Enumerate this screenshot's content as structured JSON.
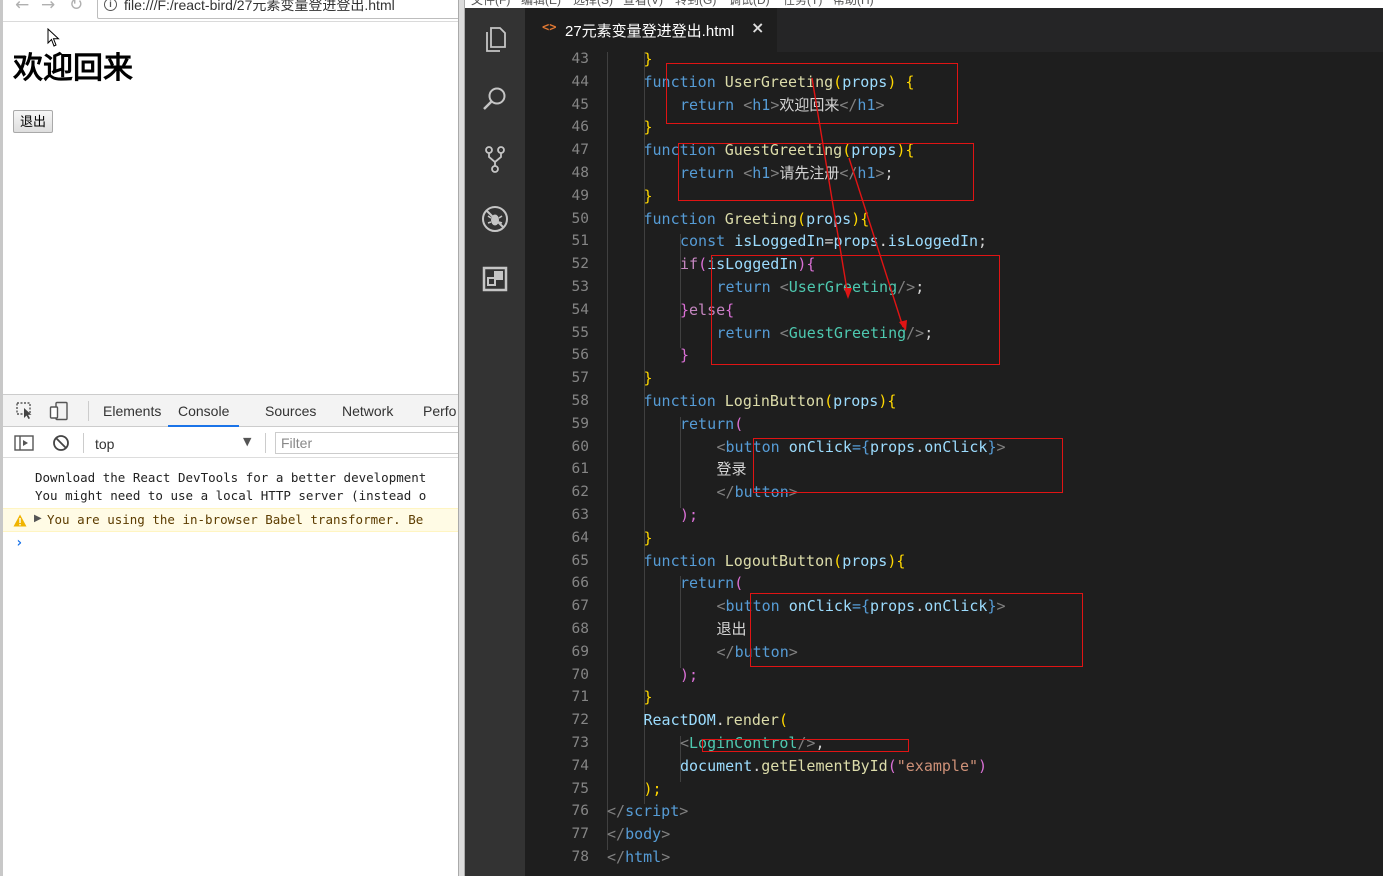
{
  "browser": {
    "url": "file:///F:/react-bird/27元素变量登进登出.html",
    "page_heading": "欢迎回来",
    "logout_button": "退出",
    "devtools": {
      "tabs": [
        "Elements",
        "Console",
        "Sources",
        "Network",
        "Perfo"
      ],
      "active_tab": "Console",
      "context": "top",
      "filter_placeholder": "Filter",
      "messages": [
        "Download the React DevTools for a better development",
        "You might need to use a local HTTP server (instead o",
        "You are using the in-browser Babel transformer. Be"
      ]
    }
  },
  "editor": {
    "menu": [
      "文件(F)",
      "编辑(E)",
      "选择(S)",
      "查看(V)",
      "转到(G)",
      "调试(D)",
      "任务(T)",
      "帮助(H)"
    ],
    "tab": {
      "icon": "<>",
      "label": "27元素变量登进登出.html"
    },
    "activity_icons": [
      "files-icon",
      "search-icon",
      "source-control-icon",
      "debug-icon",
      "extensions-icon"
    ],
    "lines": [
      {
        "n": "43",
        "tokens": [
          [
            "}",
            "t-yel"
          ]
        ],
        "indent": 2
      },
      {
        "n": "44",
        "tokens": [
          [
            "function ",
            "t-kw"
          ],
          [
            "UserGreeting",
            "t-fn"
          ],
          [
            "(",
            "t-par"
          ],
          [
            "props",
            "t-var"
          ],
          ") ",
          "t-par"
        ],
        "indent": 2
      },
      {
        "n": "45",
        "tokens": [],
        "indent": 3
      },
      {
        "n": "46",
        "tokens": [],
        "indent": 2
      },
      {
        "n": "47",
        "tokens": [],
        "indent": 2
      },
      {
        "n": "48",
        "tokens": [],
        "indent": 3
      },
      {
        "n": "49",
        "tokens": [],
        "indent": 2
      },
      {
        "n": "50",
        "tokens": [],
        "indent": 2
      },
      {
        "n": "51",
        "tokens": [],
        "indent": 3
      },
      {
        "n": "52",
        "tokens": [],
        "indent": 3
      },
      {
        "n": "53",
        "tokens": [],
        "indent": 4
      },
      {
        "n": "54",
        "tokens": [],
        "indent": 3
      },
      {
        "n": "55",
        "tokens": [],
        "indent": 4
      },
      {
        "n": "56",
        "tokens": [],
        "indent": 3
      },
      {
        "n": "57",
        "tokens": [],
        "indent": 2
      },
      {
        "n": "58",
        "tokens": [],
        "indent": 2
      },
      {
        "n": "59",
        "tokens": [],
        "indent": 3
      },
      {
        "n": "60",
        "tokens": [],
        "indent": 4
      },
      {
        "n": "61",
        "tokens": [],
        "indent": 4
      },
      {
        "n": "62",
        "tokens": [],
        "indent": 4
      },
      {
        "n": "63",
        "tokens": [],
        "indent": 3
      },
      {
        "n": "64",
        "tokens": [],
        "indent": 2
      },
      {
        "n": "65",
        "tokens": [],
        "indent": 2
      },
      {
        "n": "66",
        "tokens": [],
        "indent": 3
      },
      {
        "n": "67",
        "tokens": [],
        "indent": 4
      },
      {
        "n": "68",
        "tokens": [],
        "indent": 4
      },
      {
        "n": "69",
        "tokens": [],
        "indent": 4
      },
      {
        "n": "70",
        "tokens": [],
        "indent": 3
      },
      {
        "n": "71",
        "tokens": [],
        "indent": 2
      },
      {
        "n": "72",
        "tokens": [],
        "indent": 2
      },
      {
        "n": "73",
        "tokens": [],
        "indent": 3
      },
      {
        "n": "74",
        "tokens": [],
        "indent": 3
      },
      {
        "n": "75",
        "tokens": [],
        "indent": 2
      },
      {
        "n": "76",
        "tokens": [],
        "indent": 1
      },
      {
        "n": "77",
        "tokens": [],
        "indent": 0
      },
      {
        "n": "78",
        "tokens": [],
        "indent": 0
      }
    ],
    "code": [
      [
        [
          "}",
          "t-yel"
        ]
      ],
      [
        [
          "function ",
          "t-kw"
        ],
        [
          "UserGreeting",
          "t-fn"
        ],
        [
          "(",
          "t-par"
        ],
        [
          "props",
          "t-var"
        ],
        [
          ") {",
          "t-par"
        ]
      ],
      [
        [
          "return ",
          "t-kw"
        ],
        [
          "<",
          "t-punct"
        ],
        [
          "h1",
          "t-tag"
        ],
        [
          ">",
          "t-punct"
        ],
        [
          "欢迎回来",
          "t-txt"
        ],
        [
          "</",
          "t-punct"
        ],
        [
          "h1",
          "t-tag"
        ],
        [
          ">",
          "t-punct"
        ]
      ],
      [
        [
          "}",
          "t-yel"
        ]
      ],
      [
        [
          "function ",
          "t-kw"
        ],
        [
          "GuestGreeting",
          "t-fn"
        ],
        [
          "(",
          "t-par"
        ],
        [
          "props",
          "t-var"
        ],
        [
          "){",
          "t-par"
        ]
      ],
      [
        [
          "return ",
          "t-kw"
        ],
        [
          "<",
          "t-punct"
        ],
        [
          "h1",
          "t-tag"
        ],
        [
          ">",
          "t-punct"
        ],
        [
          "请先注册",
          "t-txt"
        ],
        [
          "</",
          "t-punct"
        ],
        [
          "h1",
          "t-tag"
        ],
        [
          ">",
          "t-punct"
        ],
        [
          ";",
          "t-txt"
        ]
      ],
      [
        [
          "}",
          "t-yel"
        ]
      ],
      [
        [
          "function ",
          "t-kw"
        ],
        [
          "Greeting",
          "t-fn"
        ],
        [
          "(",
          "t-par"
        ],
        [
          "props",
          "t-var"
        ],
        [
          "){",
          "t-par"
        ]
      ],
      [
        [
          "const ",
          "t-kw"
        ],
        [
          "isLoggedIn",
          "t-var"
        ],
        [
          "=",
          "t-txt"
        ],
        [
          "props",
          "t-var"
        ],
        [
          ".",
          "t-txt"
        ],
        [
          "isLoggedIn",
          "t-var"
        ],
        [
          ";",
          "t-txt"
        ]
      ],
      [
        [
          "if",
          "t-ctl"
        ],
        [
          "(",
          "t-pur"
        ],
        [
          "isLoggedIn",
          "t-var"
        ],
        [
          "){",
          "t-pur"
        ]
      ],
      [
        [
          "return ",
          "t-kw"
        ],
        [
          "<",
          "t-punct"
        ],
        [
          "UserGreeting",
          "t-cmp"
        ],
        [
          "/>",
          "t-punct"
        ],
        [
          ";",
          "t-txt"
        ]
      ],
      [
        [
          "}",
          "t-pur"
        ],
        [
          "else",
          "t-ctl"
        ],
        [
          "{",
          "t-pur"
        ]
      ],
      [
        [
          "return ",
          "t-kw"
        ],
        [
          "<",
          "t-punct"
        ],
        [
          "GuestGreeting",
          "t-cmp"
        ],
        [
          "/>",
          "t-punct"
        ],
        [
          ";",
          "t-txt"
        ]
      ],
      [
        [
          "}",
          "t-pur"
        ]
      ],
      [
        [
          "}",
          "t-yel"
        ]
      ],
      [
        [
          "function ",
          "t-kw"
        ],
        [
          "LoginButton",
          "t-fn"
        ],
        [
          "(",
          "t-par"
        ],
        [
          "props",
          "t-var"
        ],
        [
          "){",
          "t-par"
        ]
      ],
      [
        [
          "return",
          "t-kw"
        ],
        [
          "(",
          "t-pur"
        ]
      ],
      [
        [
          "<",
          "t-punct"
        ],
        [
          "button ",
          "t-tag"
        ],
        [
          "onClick",
          "t-var"
        ],
        [
          "={",
          "t-kw"
        ],
        [
          "props",
          "t-var"
        ],
        [
          ".",
          "t-txt"
        ],
        [
          "onClick",
          "t-var"
        ],
        [
          "}",
          "t-kw"
        ],
        [
          ">",
          "t-punct"
        ]
      ],
      [
        [
          "登录",
          "t-txt"
        ]
      ],
      [
        [
          "</",
          "t-punct"
        ],
        [
          "button",
          "t-tag"
        ],
        [
          ">",
          "t-punct"
        ]
      ],
      [
        [
          ");",
          "t-pur"
        ]
      ],
      [
        [
          "}",
          "t-yel"
        ]
      ],
      [
        [
          "function ",
          "t-kw"
        ],
        [
          "LogoutButton",
          "t-fn"
        ],
        [
          "(",
          "t-par"
        ],
        [
          "props",
          "t-var"
        ],
        [
          "){",
          "t-par"
        ]
      ],
      [
        [
          "return",
          "t-kw"
        ],
        [
          "(",
          "t-pur"
        ]
      ],
      [
        [
          "<",
          "t-punct"
        ],
        [
          "button ",
          "t-tag"
        ],
        [
          "onClick",
          "t-var"
        ],
        [
          "={",
          "t-kw"
        ],
        [
          "props",
          "t-var"
        ],
        [
          ".",
          "t-txt"
        ],
        [
          "onClick",
          "t-var"
        ],
        [
          "}",
          "t-kw"
        ],
        [
          ">",
          "t-punct"
        ]
      ],
      [
        [
          "退出",
          "t-txt"
        ]
      ],
      [
        [
          "</",
          "t-punct"
        ],
        [
          "button",
          "t-tag"
        ],
        [
          ">",
          "t-punct"
        ]
      ],
      [
        [
          ");",
          "t-pur"
        ]
      ],
      [
        [
          "}",
          "t-yel"
        ]
      ],
      [
        [
          "ReactDOM",
          "t-var"
        ],
        [
          ".",
          "t-txt"
        ],
        [
          "render",
          "t-fn"
        ],
        [
          "(",
          "t-yel"
        ]
      ],
      [
        [
          "<",
          "t-punct"
        ],
        [
          "LoginControl",
          "t-cmp"
        ],
        [
          "/>",
          "t-punct"
        ],
        [
          ",",
          "t-txt"
        ]
      ],
      [
        [
          "document",
          "t-var"
        ],
        [
          ".",
          "t-txt"
        ],
        [
          "getElementById",
          "t-fn"
        ],
        [
          "(",
          "t-pur"
        ],
        [
          "\"example\"",
          "t-str"
        ],
        [
          ")",
          "t-pur"
        ]
      ],
      [
        [
          ");",
          "t-yel"
        ]
      ],
      [
        [
          "</",
          "t-punct"
        ],
        [
          "script",
          "t-tag"
        ],
        [
          ">",
          "t-punct"
        ]
      ],
      [
        [
          "</",
          "t-punct"
        ],
        [
          "body",
          "t-tag"
        ],
        [
          ">",
          "t-punct"
        ]
      ],
      [
        [
          "</",
          "t-punct"
        ],
        [
          "html",
          "t-tag"
        ],
        [
          ">",
          "t-punct"
        ]
      ]
    ]
  }
}
